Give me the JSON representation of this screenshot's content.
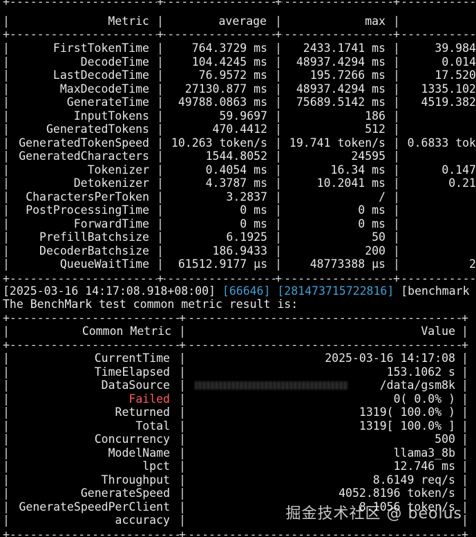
{
  "table1": {
    "border_top": "+-------------------------+------------------+-------------------+-----------",
    "headers": [
      "Metric",
      "average",
      "max"
    ],
    "rows": [
      {
        "metric": "FirstTokenTime",
        "average": "764.3729 ms",
        "max": "2433.1741 ms",
        "min": "39.984"
      },
      {
        "metric": "DecodeTime",
        "average": "104.4245 ms",
        "max": "48937.4294 ms",
        "min": "0.014"
      },
      {
        "metric": "LastDecodeTime",
        "average": "76.9572 ms",
        "max": "195.7266 ms",
        "min": "17.520"
      },
      {
        "metric": "MaxDecodeTime",
        "average": "27130.877 ms",
        "max": "48937.4294 ms",
        "min": "1335.102"
      },
      {
        "metric": "GenerateTime",
        "average": "49788.0863 ms",
        "max": "75689.5142 ms",
        "min": "4519.382"
      },
      {
        "metric": "InputTokens",
        "average": "59.9697",
        "max": "186",
        "min": ""
      },
      {
        "metric": "GeneratedTokens",
        "average": "470.4412",
        "max": "512",
        "min": ""
      },
      {
        "metric": "GeneratedTokenSpeed",
        "average": "10.263 token/s",
        "max": "19.741 token/s",
        "min": "0.6833 tok"
      },
      {
        "metric": "GeneratedCharacters",
        "average": "1544.8052",
        "max": "24595",
        "min": ""
      },
      {
        "metric": "Tokenizer",
        "average": "0.4054 ms",
        "max": "16.34 ms",
        "min": "0.147"
      },
      {
        "metric": "Detokenizer",
        "average": "4.3787 ms",
        "max": "10.2041 ms",
        "min": "0.21"
      },
      {
        "metric": "CharactersPerToken",
        "average": "3.2837",
        "max": "/",
        "min": ""
      },
      {
        "metric": "PostProcessingTime",
        "average": "0 ms",
        "max": "0 ms",
        "min": ""
      },
      {
        "metric": "ForwardTime",
        "average": "0 ms",
        "max": "0 ms",
        "min": ""
      },
      {
        "metric": "PrefillBatchsize",
        "average": "6.1925",
        "max": "50",
        "min": ""
      },
      {
        "metric": "DecoderBatchsize",
        "average": "186.9433",
        "max": "200",
        "min": ""
      },
      {
        "metric": "QueueWaitTime",
        "average": "61512.9177 μs",
        "max": "48773388 μs",
        "min": "2"
      }
    ]
  },
  "log": {
    "timestamp": "[2025-03-16 14:17:08.918+08:00]",
    "pid": "[66646]",
    "tid": "[281473715722816]",
    "tag": "[benchmark",
    "message": "The BenchMark test common metric result is:"
  },
  "table2": {
    "headers": [
      "Common Metric",
      "Value"
    ],
    "rows": [
      {
        "metric": "CurrentTime",
        "value": "2025-03-16 14:17:08",
        "status": "normal"
      },
      {
        "metric": "TimeElapsed",
        "value": "153.1062 s",
        "status": "normal"
      },
      {
        "metric": "DataSource",
        "value": "/data/gsm8k",
        "status": "redacted"
      },
      {
        "metric": "Failed",
        "value": "0( 0.0% )",
        "status": "error"
      },
      {
        "metric": "Returned",
        "value": "1319( 100.0% )",
        "status": "normal"
      },
      {
        "metric": "Total",
        "value": "1319[ 100.0% ]",
        "status": "normal"
      },
      {
        "metric": "Concurrency",
        "value": "500",
        "status": "normal"
      },
      {
        "metric": "ModelName",
        "value": "llama3_8b",
        "status": "normal"
      },
      {
        "metric": "lpct",
        "value": "12.746 ms",
        "status": "normal"
      },
      {
        "metric": "Throughput",
        "value": "8.6149 req/s",
        "status": "normal"
      },
      {
        "metric": "GenerateSpeed",
        "value": "4052.8196 token/s",
        "status": "normal"
      },
      {
        "metric": "GenerateSpeedPerClient",
        "value": "8.1056 token/s",
        "status": "normal"
      },
      {
        "metric": "accuracy",
        "value": "",
        "status": "normal"
      }
    ]
  },
  "watermark": "掘金技术社区 @ beolus",
  "colors": {
    "background": "#000000",
    "text": "#e8e8e8",
    "failed": "#ff5b5b",
    "log_ids": "#3fa0d8"
  }
}
